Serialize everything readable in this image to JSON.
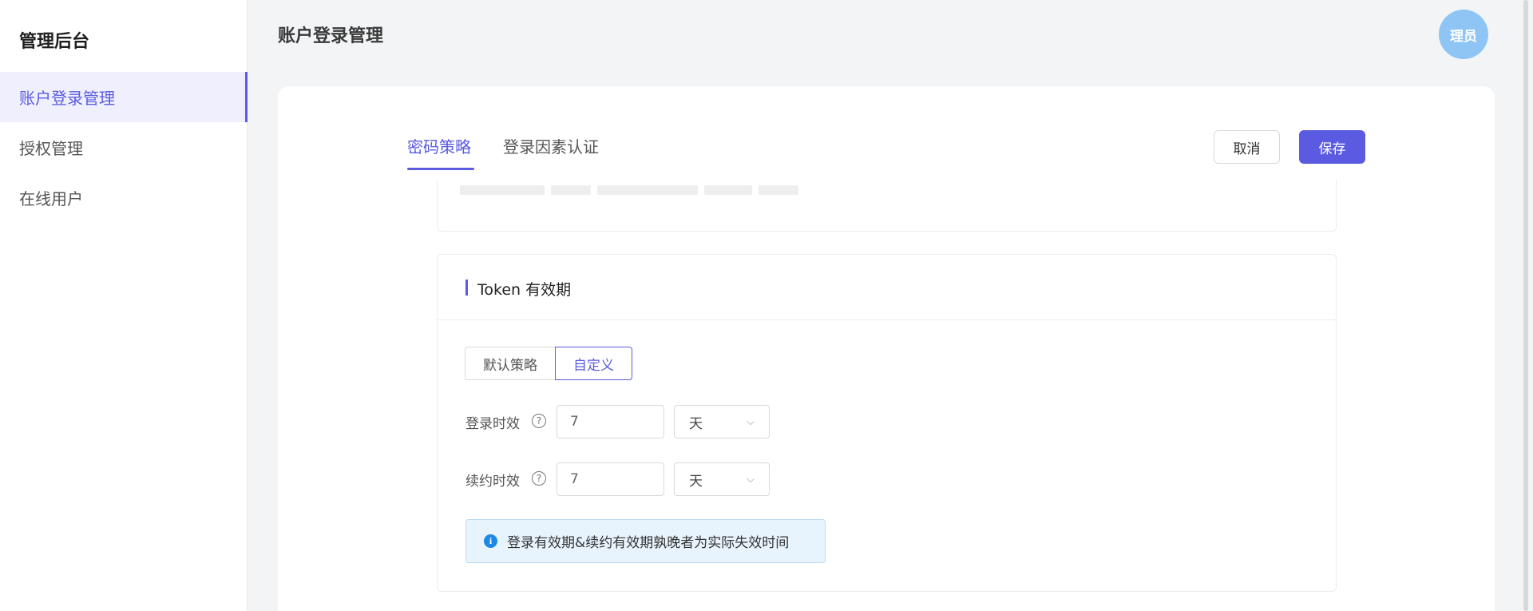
{
  "sidebar": {
    "brand": "管理后台",
    "items": [
      {
        "label": "账户登录管理",
        "active": true
      },
      {
        "label": "授权管理",
        "active": false
      },
      {
        "label": "在线用户",
        "active": false
      }
    ]
  },
  "header": {
    "title": "账户登录管理",
    "avatar_text": "理员"
  },
  "tabs": [
    {
      "label": "密码策略",
      "active": true
    },
    {
      "label": "登录因素认证",
      "active": false
    }
  ],
  "actions": {
    "cancel_label": "取消",
    "save_label": "保存"
  },
  "token_section": {
    "title": "Token 有效期",
    "strategy_options": [
      {
        "label": "默认策略",
        "selected": false
      },
      {
        "label": "自定义",
        "selected": true
      }
    ],
    "fields": [
      {
        "label": "登录时效",
        "value": "7",
        "unit": "天"
      },
      {
        "label": "续约时效",
        "value": "7",
        "unit": "天"
      }
    ],
    "info": "登录有效期&续约有效期孰晚者为实际失效时间"
  },
  "colors": {
    "accent": "#5a5be0",
    "info_bg": "#e8f4fd",
    "info_icon": "#1e88e5",
    "avatar": "#8ec5f5"
  }
}
